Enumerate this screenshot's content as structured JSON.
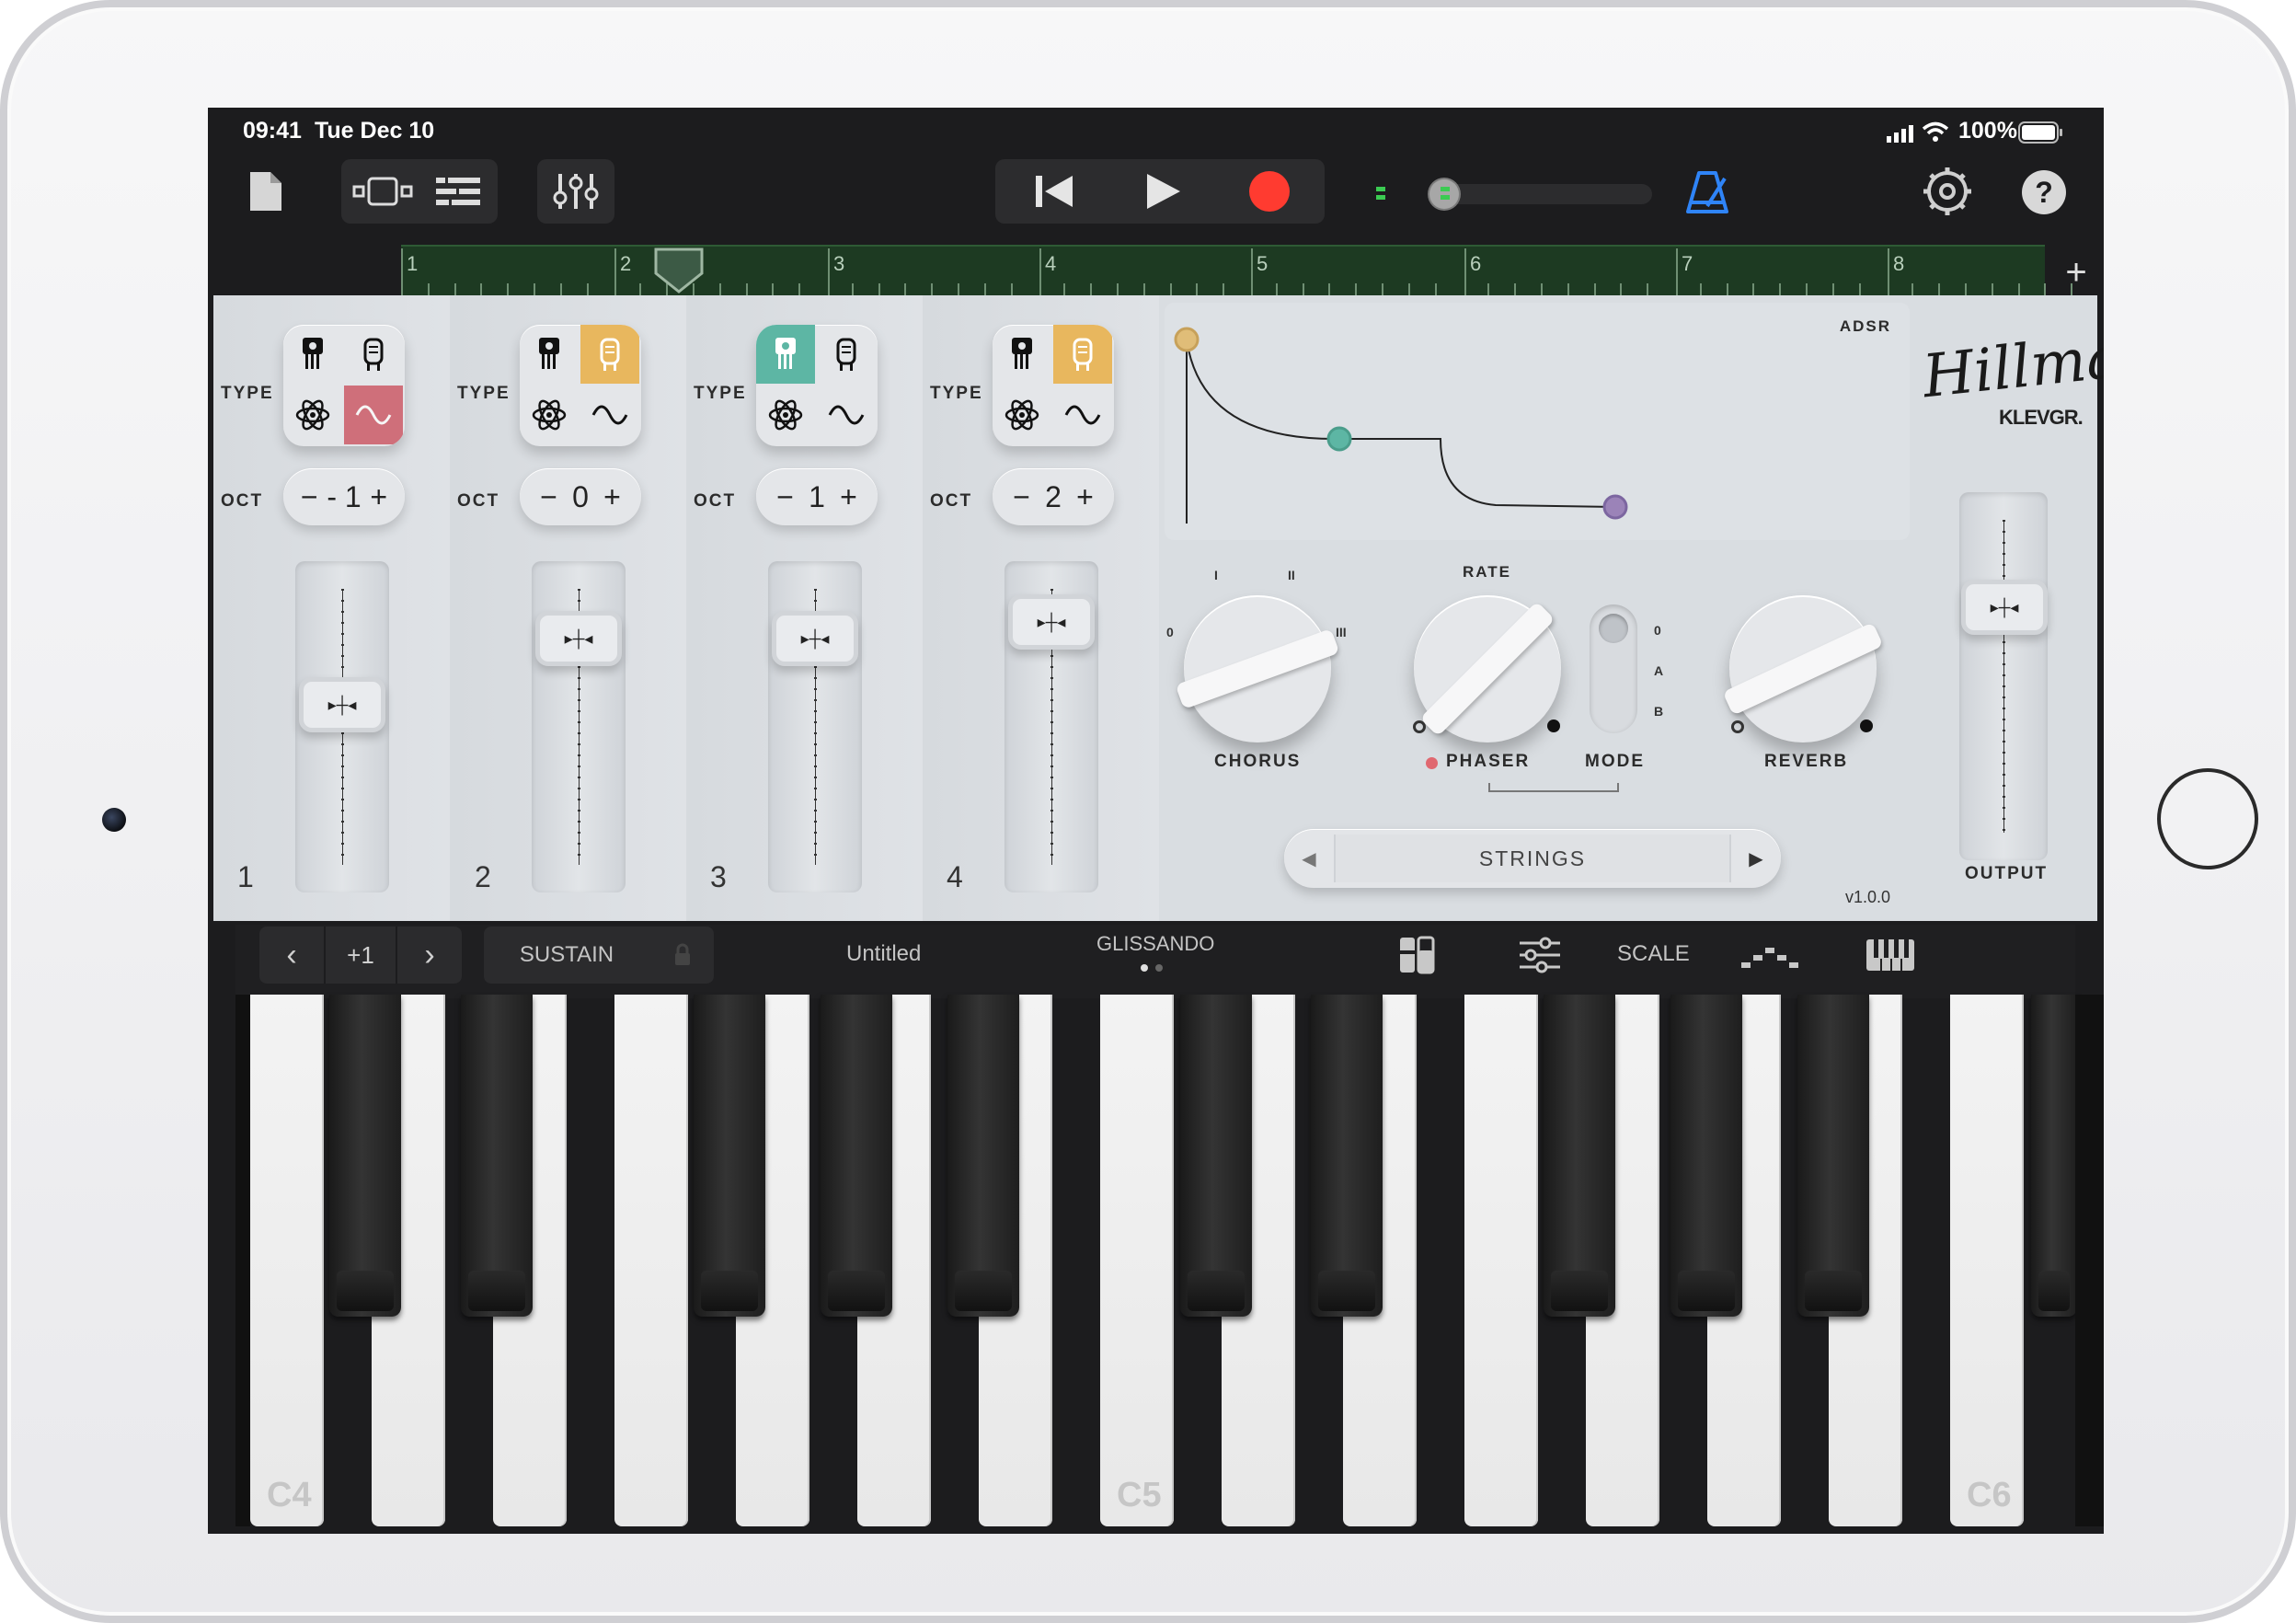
{
  "status": {
    "time": "09:41",
    "date": "Tue Dec 10",
    "battery": "100%"
  },
  "toolbar": {
    "icons": [
      "document-icon",
      "tracks-view-icon",
      "list-view-icon",
      "mixer-icon",
      "rewind-icon",
      "play-icon",
      "record-icon",
      "volume-slider",
      "metronome-icon",
      "settings-icon",
      "help-icon"
    ],
    "help_label": "?"
  },
  "ruler": {
    "bars": [
      "1",
      "2",
      "3",
      "4",
      "5",
      "6",
      "7",
      "8"
    ],
    "add_label": "+"
  },
  "channels": [
    {
      "number": "1",
      "type_label": "TYPE",
      "oct_label": "OCT",
      "octave": "- 1",
      "fader_level": 0.58
    },
    {
      "number": "2",
      "type_label": "TYPE",
      "oct_label": "OCT",
      "octave": "0",
      "fader_level": 0.82
    },
    {
      "number": "3",
      "type_label": "TYPE",
      "oct_label": "OCT",
      "octave": "1",
      "fader_level": 0.82
    },
    {
      "number": "4",
      "type_label": "TYPE",
      "oct_label": "OCT",
      "octave": "2",
      "fader_level": 0.88
    }
  ],
  "adsr": {
    "label": "ADSR"
  },
  "brand": {
    "script": "Hillman",
    "maker": "KLEVGR."
  },
  "effects": {
    "chorus": {
      "label": "CHORUS",
      "marks": [
        "0",
        "I",
        "II",
        "III"
      ]
    },
    "phaser": {
      "label": "PHASER",
      "rate_label": "RATE"
    },
    "mode": {
      "label": "MODE",
      "options": [
        "0",
        "A",
        "B"
      ]
    },
    "reverb": {
      "label": "REVERB"
    }
  },
  "preset": {
    "name": "STRINGS"
  },
  "output": {
    "label": "OUTPUT",
    "level": 0.72
  },
  "version": "v1.0.0",
  "keyboard_bar": {
    "octave": "+1",
    "sustain": "SUSTAIN",
    "song": "Untitled",
    "glissando": "GLISSANDO",
    "scale": "SCALE"
  },
  "keys": {
    "c4": "C4",
    "c5": "C5",
    "c6": "C6"
  },
  "colors": {
    "accent_yellow": "#e8b75e",
    "accent_teal": "#5db6a4",
    "accent_red": "#cf6f7a",
    "record": "#ff3b30",
    "ruler_green": "#1d3a22",
    "metronome_blue": "#2f84f7"
  }
}
